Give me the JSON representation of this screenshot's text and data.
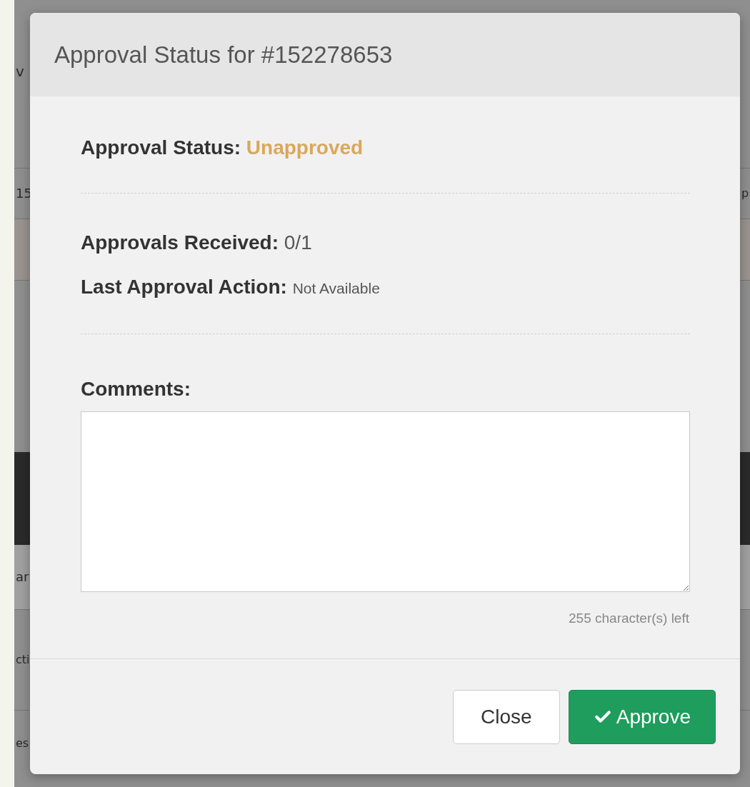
{
  "backdrop": {
    "left_fragments": [
      "v",
      "15",
      "ar",
      "cti",
      "es"
    ],
    "right_fragments": [
      "p"
    ]
  },
  "dialog": {
    "title": "Approval Status for #152278653",
    "status": {
      "label": "Approval Status:",
      "value": "Unapproved",
      "kind": "unapproved"
    },
    "details": [
      {
        "label": "Approvals Received:",
        "value": "0/1",
        "kind": "count"
      },
      {
        "label": "Last Approval Action:",
        "value": "Not Available",
        "kind": "note"
      }
    ],
    "comments": {
      "label": "Comments:",
      "counter": "255 character(s) left"
    },
    "buttons": [
      {
        "label": "Close",
        "kind": "secondary"
      },
      {
        "label": "Approve",
        "kind": "primary"
      }
    ]
  }
}
